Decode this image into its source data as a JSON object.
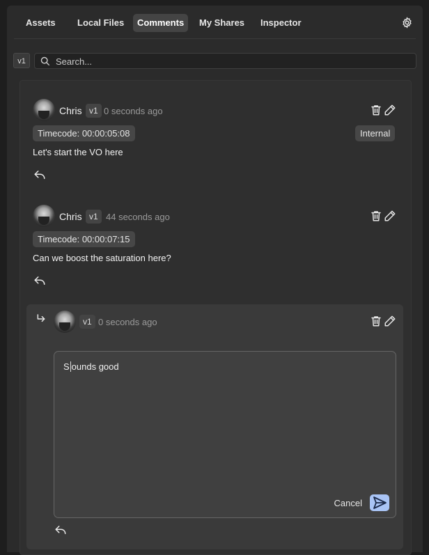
{
  "tabs": [
    {
      "label": "Assets",
      "active": false
    },
    {
      "label": "Local Files",
      "active": false
    },
    {
      "label": "Comments",
      "active": true
    },
    {
      "label": "My Shares",
      "active": false
    },
    {
      "label": "Inspector",
      "active": false
    }
  ],
  "version_filter": "v1",
  "search": {
    "placeholder": "Search...",
    "value": ""
  },
  "comments": [
    {
      "author": "Chris",
      "version": "v1",
      "time": "0 seconds ago",
      "timecode": "Timecode: 00:00:05:08",
      "tag": "Internal",
      "text": "Let's start the VO here"
    },
    {
      "author": "Chris",
      "version": "v1",
      "time": "44 seconds ago",
      "timecode": "Timecode: 00:00:07:15",
      "text": "Can we boost the saturation here?"
    }
  ],
  "reply": {
    "version": "v1",
    "time": "0 seconds ago",
    "draft_before_caret": "S",
    "draft_after_caret": "ounds good",
    "cancel_label": "Cancel"
  },
  "colors": {
    "accent": "#a9c4f5",
    "background": "#2b2b2b"
  }
}
